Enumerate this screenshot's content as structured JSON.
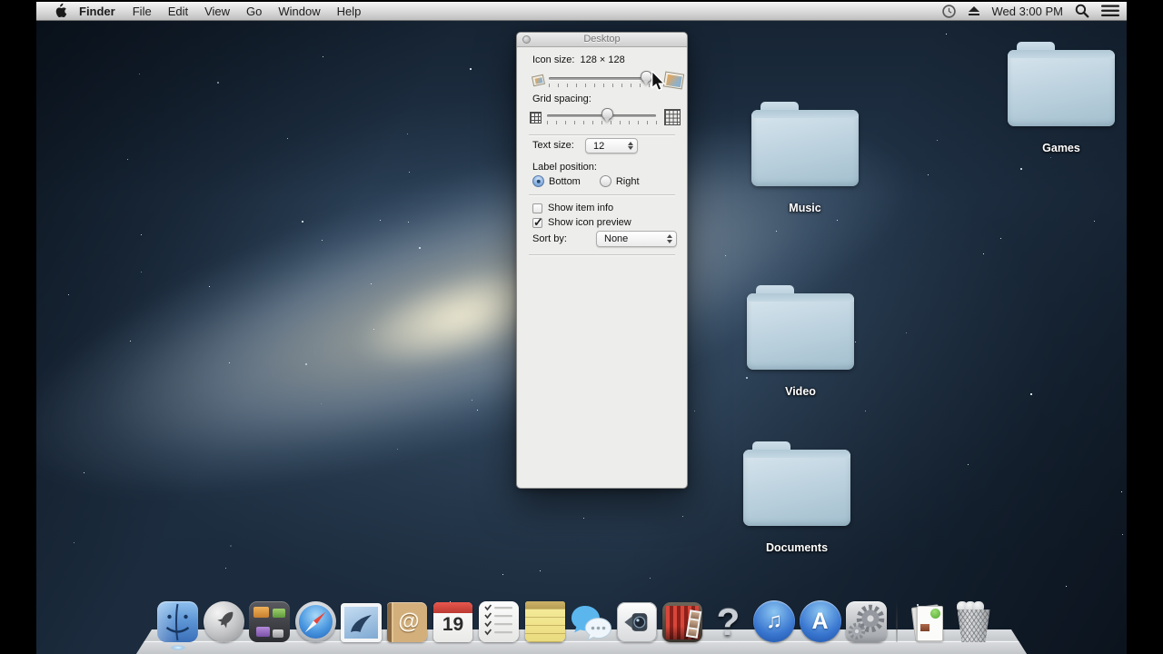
{
  "menu_bar": {
    "menus": [
      "Finder",
      "File",
      "Edit",
      "View",
      "Go",
      "Window",
      "Help"
    ],
    "clock": "Wed 3:00 PM"
  },
  "view_options": {
    "title": "Desktop",
    "icon_size_label": "Icon size:",
    "icon_size_value": "128 × 128",
    "grid_spacing_label": "Grid spacing:",
    "text_size_label": "Text size:",
    "text_size_value": "12",
    "label_position_label": "Label position:",
    "label_position_options": [
      "Bottom",
      "Right"
    ],
    "label_position_selected_index": 0,
    "checkboxes": [
      {
        "key": "show_item_info",
        "label": "Show item info",
        "checked": false
      },
      {
        "key": "show_icon_preview",
        "label": "Show icon preview",
        "checked": true
      }
    ],
    "sort_by_label": "Sort by:",
    "sort_by_value": "None"
  },
  "desktop": {
    "folders": [
      {
        "label": "Games"
      },
      {
        "label": "Music"
      },
      {
        "label": "Video"
      },
      {
        "label": "Documents"
      }
    ]
  },
  "dock": {
    "items": [
      {
        "name": "finder",
        "running": true
      },
      {
        "name": "launchpad"
      },
      {
        "name": "mission-control"
      },
      {
        "name": "safari"
      },
      {
        "name": "mail"
      },
      {
        "name": "contacts"
      },
      {
        "name": "calendar",
        "day": "19"
      },
      {
        "name": "reminders"
      },
      {
        "name": "notes"
      },
      {
        "name": "messages"
      },
      {
        "name": "facetime"
      },
      {
        "name": "photo-booth"
      },
      {
        "name": "question-mark",
        "glyph": "?"
      },
      {
        "name": "itunes"
      },
      {
        "name": "app-store"
      },
      {
        "name": "system-preferences"
      },
      {
        "name": "downloads"
      },
      {
        "name": "trash"
      }
    ]
  },
  "colors": {
    "selection_blue": "#5d8bc3",
    "folder_blue": "#b7cfdd",
    "menubar_text": "#1c1c1c"
  }
}
